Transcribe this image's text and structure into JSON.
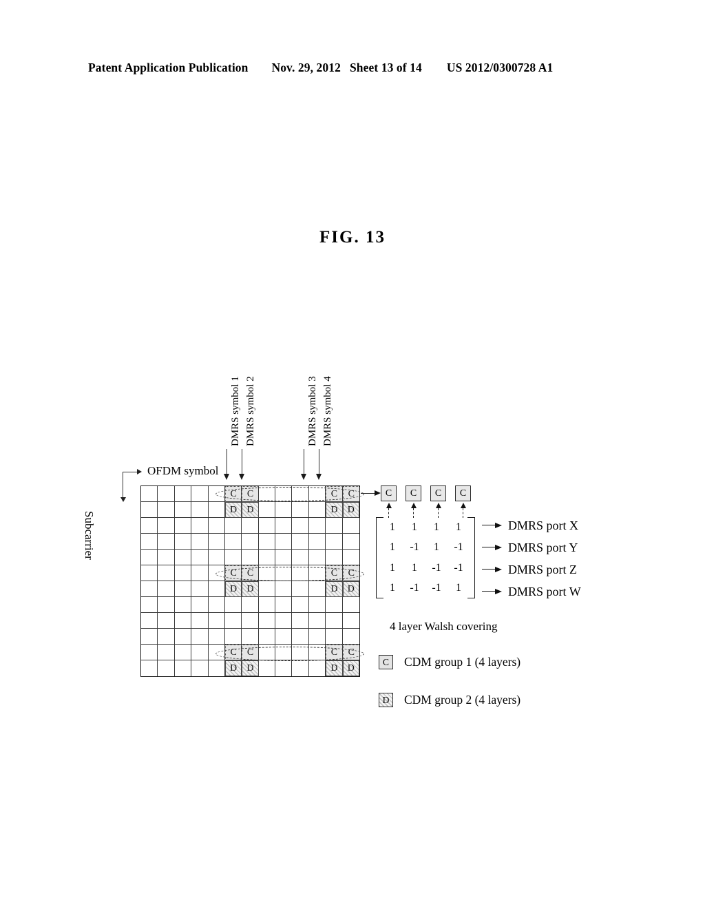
{
  "header": {
    "publication": "Patent Application Publication",
    "date": "Nov. 29, 2012",
    "sheet": "Sheet 13 of 14",
    "number": "US 2012/0300728 A1"
  },
  "figure": {
    "title": "FIG. 13",
    "axes": {
      "x_label": "OFDM symbol",
      "y_label": "Subcarrier"
    },
    "column_callouts": [
      {
        "label": "DMRS symbol 1",
        "column": 6
      },
      {
        "label": "DMRS symbol 2",
        "column": 7
      },
      {
        "label": "DMRS symbol 3",
        "column": 12
      },
      {
        "label": "DMRS symbol 4",
        "column": 13
      }
    ],
    "grid": {
      "columns": 13,
      "rows": 12,
      "c_columns": [
        6,
        7,
        12,
        13
      ],
      "c_rows": [
        1,
        6,
        11
      ],
      "d_rows": [
        2,
        7,
        12
      ],
      "c_glyph": "C",
      "d_glyph": "D"
    },
    "c_boxes": [
      {
        "label": "C"
      },
      {
        "label": "C"
      },
      {
        "label": "C"
      },
      {
        "label": "C"
      }
    ],
    "walsh_matrix": {
      "rows": [
        [
          "1",
          "1",
          "1",
          "1"
        ],
        [
          "1",
          "-1",
          "1",
          "-1"
        ],
        [
          "1",
          "1",
          "-1",
          "-1"
        ],
        [
          "1",
          "-1",
          "-1",
          "1"
        ]
      ]
    },
    "dmrs_ports": [
      "DMRS port X",
      "DMRS port Y",
      "DMRS port Z",
      "DMRS port W"
    ],
    "walsh_caption": "4 layer Walsh covering",
    "legend": [
      {
        "glyph": "C",
        "text": "CDM group 1 (4 layers)"
      },
      {
        "glyph": "D",
        "text": "CDM group 2 (4 layers)"
      }
    ]
  },
  "colors": {
    "ink": "#000000",
    "grid_line": "#3c3c3c",
    "c_fill": "#e6e6e6",
    "d_hatch": "#bfbfbf",
    "page": "#ffffff"
  }
}
